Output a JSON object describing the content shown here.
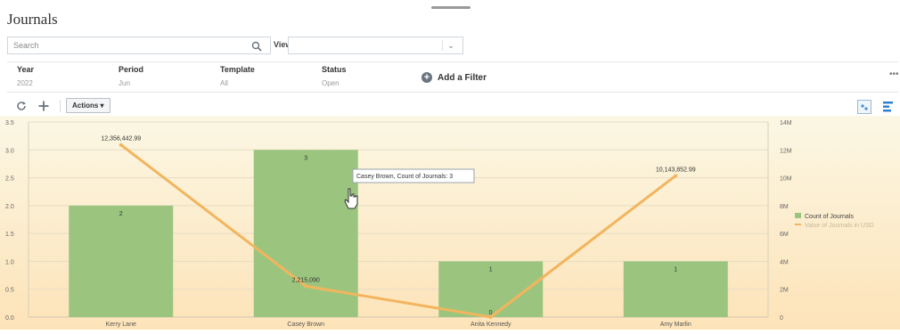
{
  "page": {
    "title": "Journals"
  },
  "search": {
    "placeholder": "Search"
  },
  "view": {
    "label": "View",
    "value": ""
  },
  "filters": [
    {
      "header": "Year",
      "value": "2022"
    },
    {
      "header": "Period",
      "value": "Jun"
    },
    {
      "header": "Template",
      "value": "All"
    },
    {
      "header": "Status",
      "value": "Open"
    }
  ],
  "add_filter_label": "Add a Filter",
  "more_label": "•••",
  "toolbar": {
    "actions_label": "Actions ▾",
    "refresh_icon": "refresh-icon",
    "add_icon": "plus-icon"
  },
  "colors": {
    "bar": "#9bc57f",
    "line": "#f2b55e",
    "bg_top": "#fbf7e4",
    "bg_bottom": "#fde3b8"
  },
  "tooltip": "Casey Brown, Count of Journals: 3",
  "chart_data": {
    "type": "bar",
    "categories": [
      "Kerry Lane",
      "Casey Brown",
      "Anita Kennedy",
      "Amy Marlin"
    ],
    "series": [
      {
        "name": "Count of Journals",
        "type": "bar",
        "axis": "left",
        "values": [
          2,
          3,
          1,
          1
        ],
        "labels": [
          "2",
          "3",
          "1",
          "1"
        ]
      },
      {
        "name": "Value of Journals in USD",
        "type": "line",
        "axis": "right",
        "values": [
          12356442.99,
          2215090,
          0,
          10143852.99
        ],
        "labels": [
          "12,356,442.99",
          "2,215,090",
          "0",
          "10,143,852.99"
        ]
      }
    ],
    "left_ticks": [
      "0.0",
      "0.5",
      "1.0",
      "1.5",
      "2.0",
      "2.5",
      "3.0",
      "3.5"
    ],
    "left_ylim": [
      0,
      3.5
    ],
    "right_ticks": [
      "0",
      "2M",
      "4M",
      "6M",
      "8M",
      "10M",
      "12M",
      "14M"
    ],
    "right_ylim": [
      0,
      14000000
    ],
    "grid": true,
    "legend_position": "right"
  }
}
